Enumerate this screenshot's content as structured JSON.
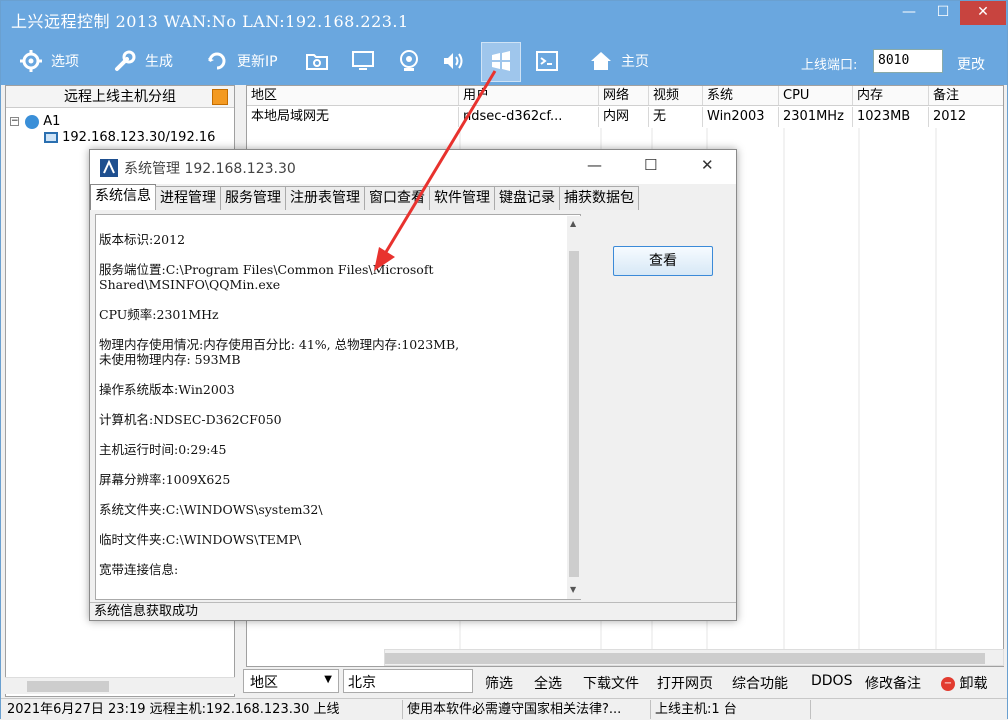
{
  "app": {
    "title": "上兴远程控制 2013 WAN:No LAN:192.168.223.1",
    "window_controls": {
      "minimize": "—",
      "maximize": "☐",
      "close": "✕"
    }
  },
  "toolbar": {
    "items": [
      {
        "label": "选项",
        "icon": "gear-icon"
      },
      {
        "label": "生成",
        "icon": "wrench-icon"
      },
      {
        "label": "更新IP",
        "icon": "refresh-icon"
      },
      {
        "label": "",
        "icon": "folder-search-icon"
      },
      {
        "label": "",
        "icon": "monitor-icon"
      },
      {
        "label": "",
        "icon": "webcam-icon"
      },
      {
        "label": "",
        "icon": "speaker-icon"
      },
      {
        "label": "",
        "icon": "windows-logo-icon"
      },
      {
        "label": "",
        "icon": "terminal-icon"
      },
      {
        "label": "主页",
        "icon": "home-icon"
      }
    ],
    "port_label": "上线端口:",
    "port_value": "8010",
    "port_button": "更改"
  },
  "left_panel": {
    "title": "远程上线主机分组",
    "group": "A1",
    "host": "192.168.123.30/192.16"
  },
  "grid": {
    "columns": [
      "地区",
      "用户",
      "网络",
      "视频",
      "系统",
      "CPU",
      "内存",
      "备注"
    ],
    "rows": [
      [
        "本地局域网无",
        "ndsec-d362cf...",
        "内网",
        "无",
        "Win2003",
        "2301MHz",
        "1023MB",
        "2012"
      ]
    ]
  },
  "bottom_bar": {
    "region_select": "地区",
    "city_input": "北京",
    "buttons": [
      "筛选",
      "全选",
      "下载文件",
      "打开网页",
      "综合功能",
      "DDOS",
      "修改备注",
      "卸载"
    ]
  },
  "status_bar": {
    "datetime": "2021年6月27日 23:19 远程主机:192.168.123.30 上线",
    "notice": "使用本软件必需遵守国家相关法律?...",
    "online_count": "上线主机:1 台"
  },
  "dialog": {
    "title": "系统管理 192.168.123.30",
    "window_controls": {
      "minimize": "—",
      "maximize": "☐",
      "close": "✕"
    },
    "tabs": [
      "系统信息",
      "进程管理",
      "服务管理",
      "注册表管理",
      "窗口查看",
      "软件管理",
      "键盘记录",
      "捕获数据包"
    ],
    "info_lines": [
      "版本标识:2012",
      "服务端位置:C:\\Program Files\\Common Files\\Microsoft",
      "Shared\\MSINFO\\QQMin.exe",
      "CPU频率:2301MHz",
      "物理内存使用情况:内存使用百分比: 41%, 总物理内存:1023MB,",
      "未使用物理内存: 593MB",
      "操作系统版本:Win2003",
      "计算机名:NDSEC-D362CF050",
      "主机运行时间:0:29:45",
      "屏幕分辨率:1009X625",
      "系统文件夹:C:\\WINDOWS\\system32\\",
      "临时文件夹:C:\\WINDOWS\\TEMP\\",
      "宽带连接信息:"
    ],
    "view_button": "查看",
    "status": "系统信息获取成功"
  },
  "colors": {
    "titlebar": "#6aa7df",
    "close_button": "#c8443f",
    "annotation_arrow": "#e8322e",
    "view_button_border": "#3b8ad8"
  }
}
